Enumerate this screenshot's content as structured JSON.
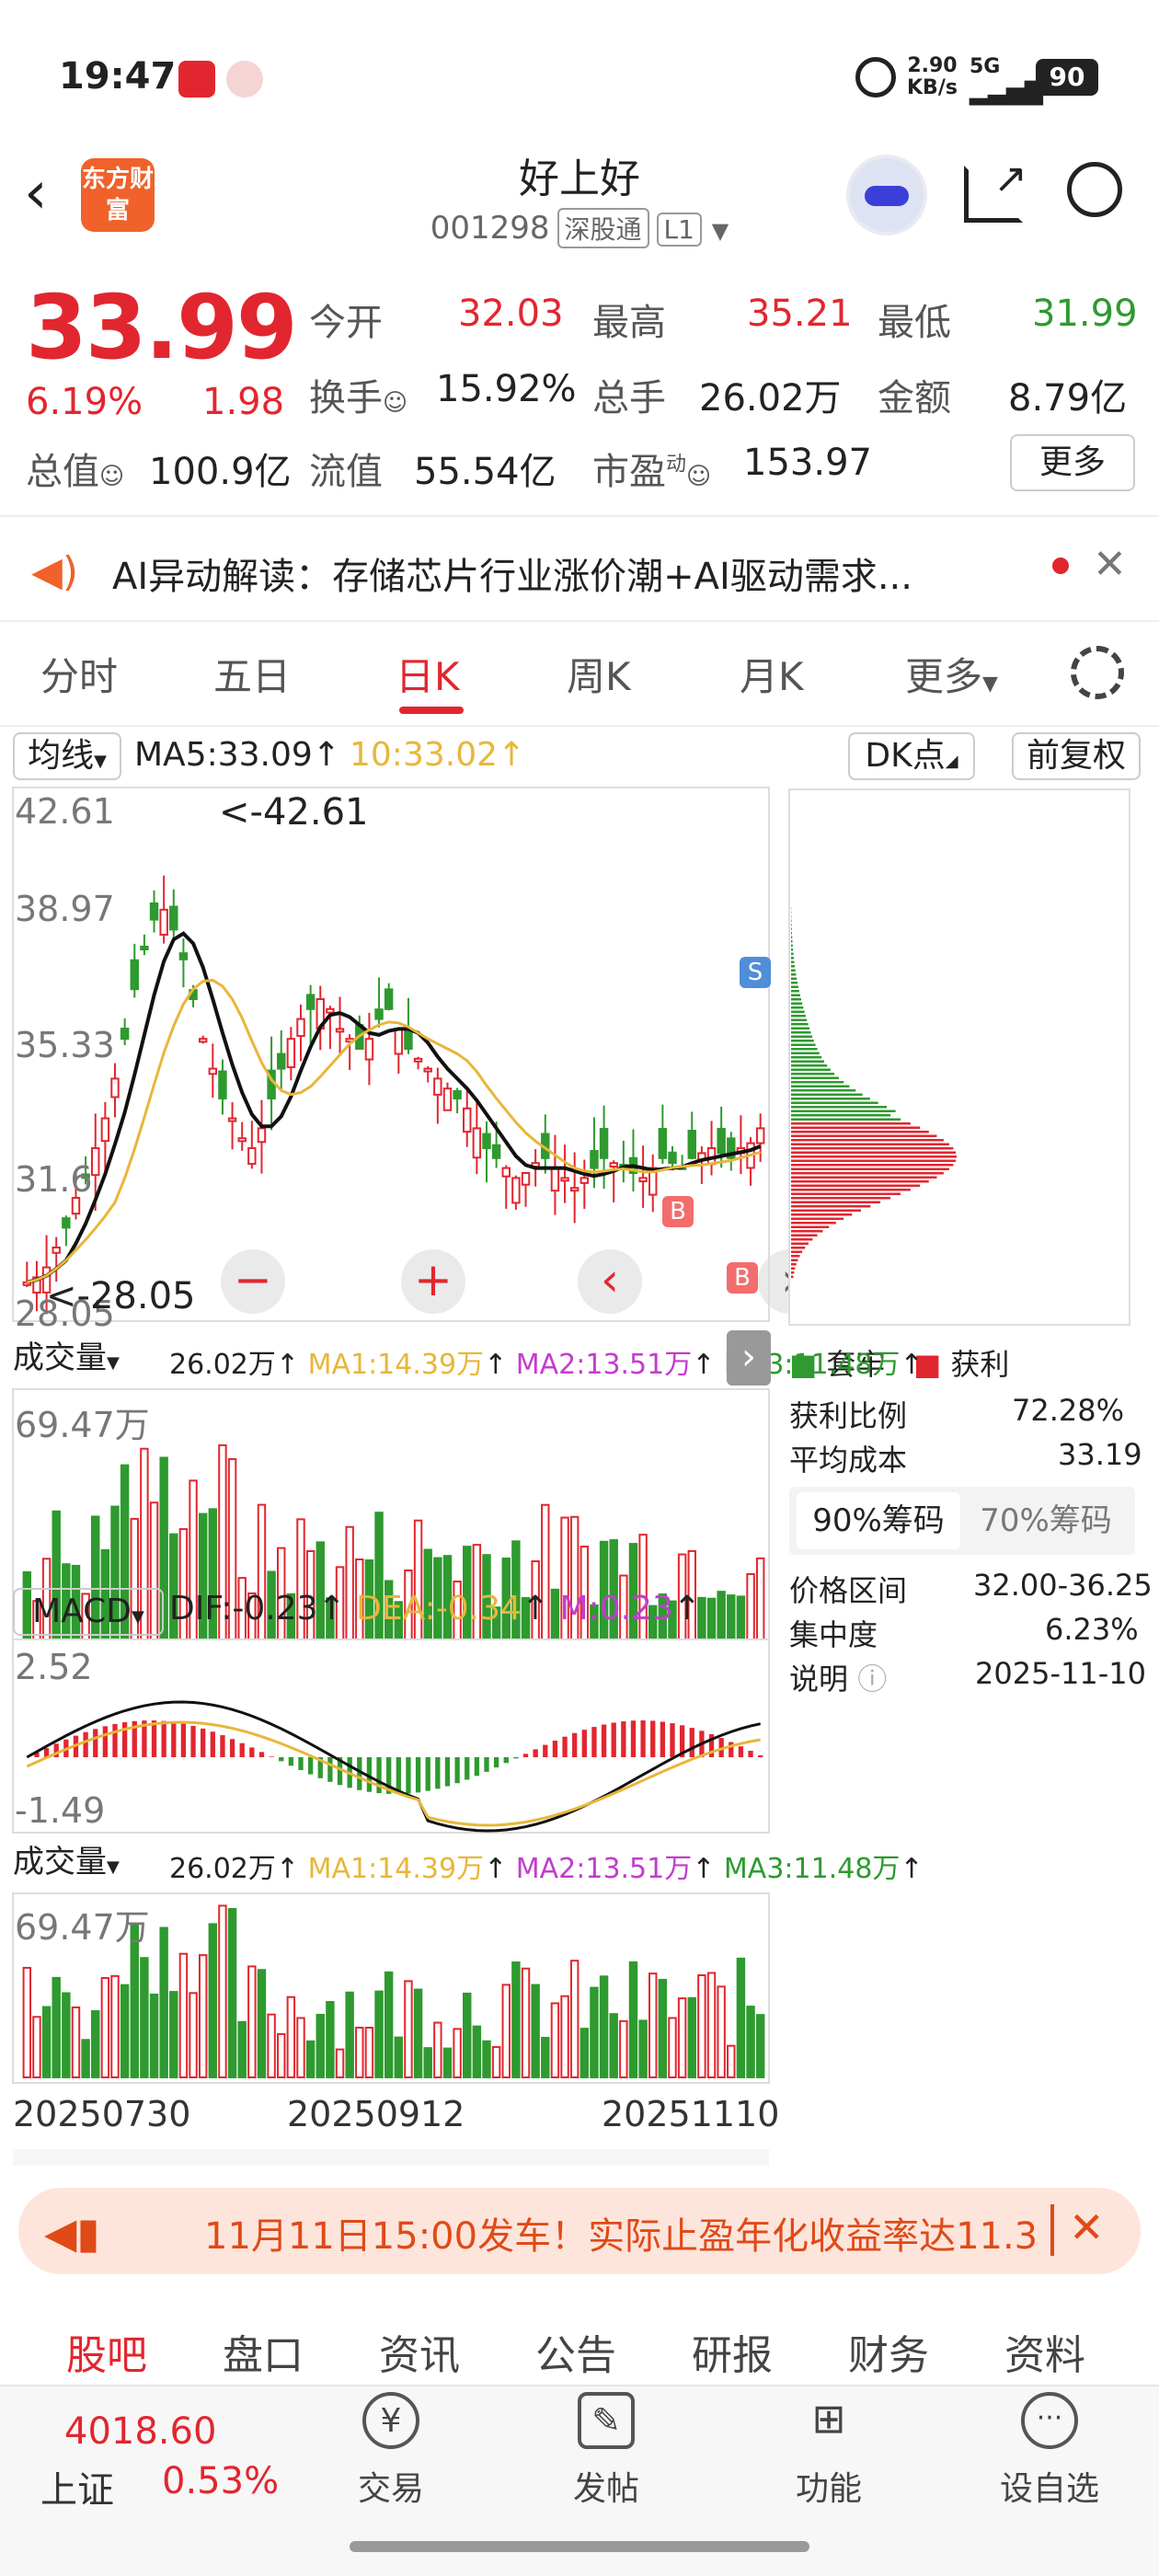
{
  "status": {
    "time": "19:47",
    "speed": "2.90",
    "speed_unit": "KB/s",
    "net": "5G",
    "battery": "90"
  },
  "header": {
    "logo": "东方财富",
    "title": "好上好",
    "code": "001298",
    "tag1": "深股通",
    "tag2": "L1"
  },
  "quote": {
    "price": "33.99",
    "pct": "6.19%",
    "chg": "1.98",
    "open_k": "今开",
    "open_v": "32.03",
    "high_k": "最高",
    "high_v": "35.21",
    "low_k": "最低",
    "low_v": "31.99",
    "turn_k": "换手",
    "turn_v": "15.92%",
    "vol_k": "总手",
    "vol_v": "26.02万",
    "amt_k": "金额",
    "amt_v": "8.79亿",
    "mcap_k": "总值",
    "mcap_v": "100.9亿",
    "float_k": "流值",
    "float_v": "55.54亿",
    "pe_k": "市盈",
    "pe_sup": "动",
    "pe_v": "153.97",
    "more": "更多"
  },
  "ai": {
    "text": "AI异动解读：存储芯片行业涨价潮+AI驱动需求..."
  },
  "tabs": [
    "分时",
    "五日",
    "日K",
    "周K",
    "月K",
    "更多"
  ],
  "kline": {
    "ma_sel": "均线",
    "ma5": "MA5:33.09",
    "ma10": "10:33.02",
    "dk": "DK点",
    "adj": "前复权",
    "ymax": "42.61",
    "y2": "38.97",
    "y3": "35.33",
    "y4": "31.6",
    "ymin": "28.05",
    "maxnote": "<-42.61",
    "minnote": "<-28.05",
    "sig_b": "B",
    "sig_s": "S"
  },
  "vol": {
    "sel": "成交量",
    "v": "26.02万",
    "ma1": "MA1:14.39万",
    "ma2": "MA2:13.51万",
    "ma3": "MA3:11.48万",
    "ytop": "69.47万"
  },
  "macd": {
    "sel": "MACD",
    "dif": "DIF:-0.23",
    "dea": "DEA:-0.34",
    "m": "M:0.23",
    "ytop": "2.52",
    "ybot": "-1.49"
  },
  "dates": [
    "20250730",
    "20250912",
    "20251110"
  ],
  "chip": {
    "leg_trap": "套牢",
    "leg_profit": "获利",
    "profit_k": "获利比例",
    "profit_v": "72.28%",
    "cost_k": "平均成本",
    "cost_v": "33.19",
    "tab90": "90%筹码",
    "tab70": "70%筹码",
    "range_k": "价格区间",
    "range_v": "32.00-36.25",
    "conc_k": "集中度",
    "conc_v": "6.23%",
    "note_k": "说明",
    "note_v": "2025-11-10"
  },
  "banner": {
    "text": "11月11日15:00发车！实际止盈年化收益率达11.3"
  },
  "bottom_tabs": [
    "股吧",
    "盘口",
    "资讯",
    "公告",
    "研报",
    "财务",
    "资料"
  ],
  "index": {
    "value": "4018.60",
    "name": "上证",
    "pct": "0.53%"
  },
  "nav": [
    "交易",
    "发帖",
    "功能",
    "设自选"
  ],
  "colors": {
    "up": "#e2262f",
    "down": "#2e9a2f",
    "ma5": "#111111",
    "ma10": "#e8b63a",
    "ma3": "#2e9a2f",
    "ma2": "#c33ccf"
  }
}
